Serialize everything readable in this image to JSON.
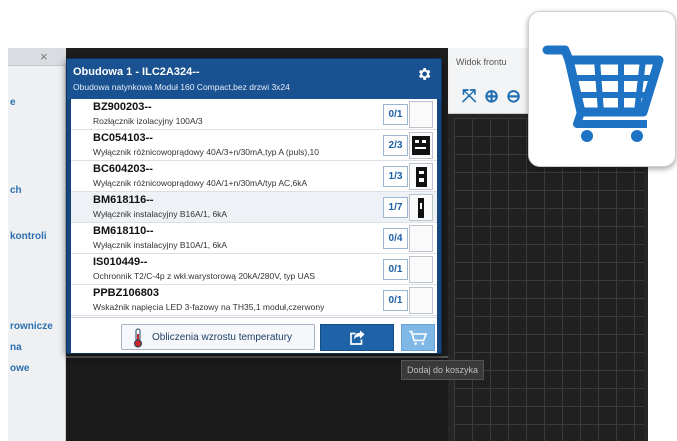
{
  "background": {
    "left_labels": [
      "e",
      "ch",
      "kontroli",
      "rownicze",
      "na",
      "owe"
    ],
    "right_title": "Widok frontu",
    "right_tools": [
      {
        "name": "fit-icon",
        "glyph": "⤧"
      },
      {
        "name": "zoom-in-icon",
        "glyph": "⊕"
      },
      {
        "name": "zoom-out-icon",
        "glyph": "⊖"
      }
    ]
  },
  "modal": {
    "title": "Obudowa 1 - ILC2A324--",
    "subtitle": "Obudowa natynkowa Moduł 160 Compact,bez drzwi 3x24",
    "gear_icon": "gear-icon",
    "items": [
      {
        "code": "BZ900203--",
        "desc": "Rozłącznik izolacyjny 100A/3",
        "count": "0/1",
        "thumb": "empty"
      },
      {
        "code": "BC054103--",
        "desc": "Wyłącznik różnicowoprądowy 40A/3+n/30mA,typ A (puls),10",
        "count": "2/3",
        "thumb": "rcd4"
      },
      {
        "code": "BC604203--",
        "desc": "Wyłącznik różnicowoprądowy 40A/1+n/30mA/typ AC,6kA",
        "count": "1/3",
        "thumb": "rcd2"
      },
      {
        "code": "BM618116--",
        "desc": "Wyłącznik instalacyjny B16A/1, 6kA",
        "count": "1/7",
        "thumb": "mcb1"
      },
      {
        "code": "BM618110--",
        "desc": "Wyłącznik instalacyjny B10A/1, 6kA",
        "count": "0/4",
        "thumb": "empty"
      },
      {
        "code": "IS010449--",
        "desc": "Ochronnik T2/C-4p z wkł.warystorową 20kA/280V, typ UAS",
        "count": "0/1",
        "thumb": "empty"
      },
      {
        "code": "PPBZ106803",
        "desc": "Wskaźnik napięcia LED 3-fazowy na TH35,1 moduł,czerwony",
        "count": "0/1",
        "thumb": "empty"
      }
    ],
    "temp_button_label": "Obliczenia wzrostu temperatury",
    "share_icon": "share-icon",
    "cart_icon": "cart-icon"
  },
  "tooltip": "Dodaj do koszyka",
  "cart_card_icon": "shopping-cart-icon",
  "colors": {
    "modal_header": "#1a5291",
    "count_text": "#1d5fa6",
    "cart_blue": "#1e73c4",
    "share_button": "#1e63a8"
  }
}
